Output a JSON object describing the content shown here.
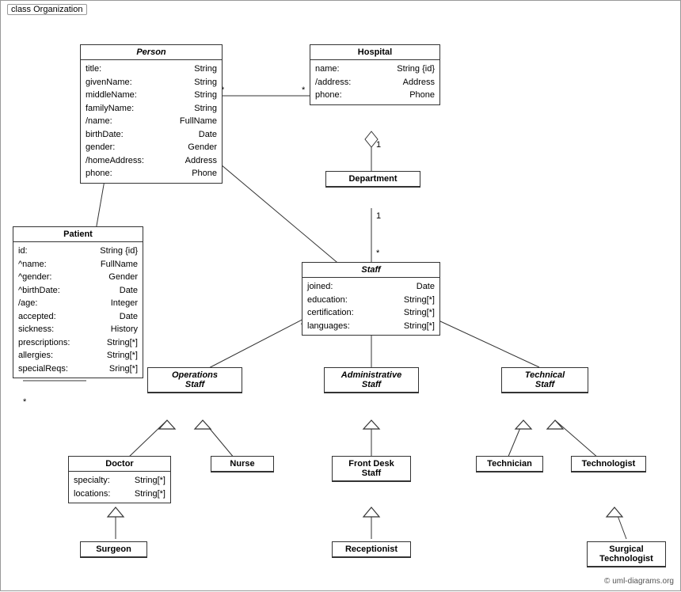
{
  "diagram": {
    "title": "class Organization",
    "copyright": "© uml-diagrams.org",
    "classes": {
      "person": {
        "name": "Person",
        "italic": true,
        "attrs": [
          {
            "name": "title:",
            "type": "String"
          },
          {
            "name": "givenName:",
            "type": "String"
          },
          {
            "name": "middleName:",
            "type": "String"
          },
          {
            "name": "familyName:",
            "type": "String"
          },
          {
            "name": "/name:",
            "type": "FullName"
          },
          {
            "name": "birthDate:",
            "type": "Date"
          },
          {
            "name": "gender:",
            "type": "Gender"
          },
          {
            "name": "/homeAddress:",
            "type": "Address"
          },
          {
            "name": "phone:",
            "type": "Phone"
          }
        ]
      },
      "hospital": {
        "name": "Hospital",
        "italic": false,
        "attrs": [
          {
            "name": "name:",
            "type": "String {id}"
          },
          {
            "name": "/address:",
            "type": "Address"
          },
          {
            "name": "phone:",
            "type": "Phone"
          }
        ]
      },
      "patient": {
        "name": "Patient",
        "italic": false,
        "attrs": [
          {
            "name": "id:",
            "type": "String {id}"
          },
          {
            "name": "^name:",
            "type": "FullName"
          },
          {
            "name": "^gender:",
            "type": "Gender"
          },
          {
            "name": "^birthDate:",
            "type": "Date"
          },
          {
            "name": "/age:",
            "type": "Integer"
          },
          {
            "name": "accepted:",
            "type": "Date"
          },
          {
            "name": "sickness:",
            "type": "History"
          },
          {
            "name": "prescriptions:",
            "type": "String[*]"
          },
          {
            "name": "allergies:",
            "type": "String[*]"
          },
          {
            "name": "specialReqs:",
            "type": "Sring[*]"
          }
        ]
      },
      "department": {
        "name": "Department",
        "italic": false,
        "attrs": []
      },
      "staff": {
        "name": "Staff",
        "italic": true,
        "attrs": [
          {
            "name": "joined:",
            "type": "Date"
          },
          {
            "name": "education:",
            "type": "String[*]"
          },
          {
            "name": "certification:",
            "type": "String[*]"
          },
          {
            "name": "languages:",
            "type": "String[*]"
          }
        ]
      },
      "operations_staff": {
        "name": "Operations Staff",
        "italic": true
      },
      "administrative_staff": {
        "name": "Administrative Staff",
        "italic": true
      },
      "technical_staff": {
        "name": "Technical Staff",
        "italic": true
      },
      "doctor": {
        "name": "Doctor",
        "italic": false,
        "attrs": [
          {
            "name": "specialty:",
            "type": "String[*]"
          },
          {
            "name": "locations:",
            "type": "String[*]"
          }
        ]
      },
      "nurse": {
        "name": "Nurse",
        "italic": false
      },
      "front_desk_staff": {
        "name": "Front Desk Staff",
        "italic": false
      },
      "technician": {
        "name": "Technician",
        "italic": false
      },
      "technologist": {
        "name": "Technologist",
        "italic": false
      },
      "surgeon": {
        "name": "Surgeon",
        "italic": false
      },
      "receptionist": {
        "name": "Receptionist",
        "italic": false
      },
      "surgical_technologist": {
        "name": "Surgical Technologist",
        "italic": false
      }
    }
  }
}
